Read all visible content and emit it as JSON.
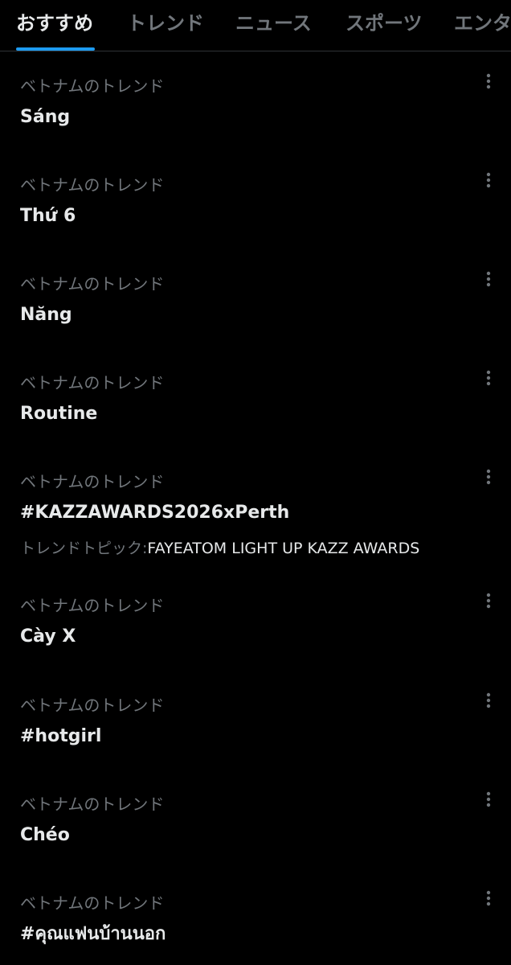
{
  "tabs": [
    {
      "label": "おすすめ",
      "active": true
    },
    {
      "label": "トレンド",
      "active": false
    },
    {
      "label": "ニュース",
      "active": false
    },
    {
      "label": "スポーツ",
      "active": false
    },
    {
      "label": "エンタ",
      "active": false
    }
  ],
  "trends": [
    {
      "context": "ベトナムのトレンド",
      "name": "Sáng"
    },
    {
      "context": "ベトナムのトレンド",
      "name": "Thứ 6"
    },
    {
      "context": "ベトナムのトレンド",
      "name": "Năng"
    },
    {
      "context": "ベトナムのトレンド",
      "name": "Routine"
    },
    {
      "context": "ベトナムのトレンド",
      "name": "#KAZZAWARDS2026xPerth",
      "topic_prefix": "トレンドトピック:",
      "topic_value": "FAYEATOM LIGHT UP KAZZ AWARDS"
    },
    {
      "context": "ベトナムのトレンド",
      "name": "Cày X"
    },
    {
      "context": "ベトナムのトレンド",
      "name": "#hotgirl"
    },
    {
      "context": "ベトナムのトレンド",
      "name": "Chéo"
    },
    {
      "context": "ベトナムのトレンド",
      "name": "#คุณแฟนบ้านนอก"
    }
  ],
  "icons": {
    "more": "more-vertical-icon"
  },
  "colors": {
    "background": "#000000",
    "primary_text": "#e7e9ea",
    "secondary_text": "#71767b",
    "accent": "#1d9bf0",
    "divider": "#2f3336"
  }
}
